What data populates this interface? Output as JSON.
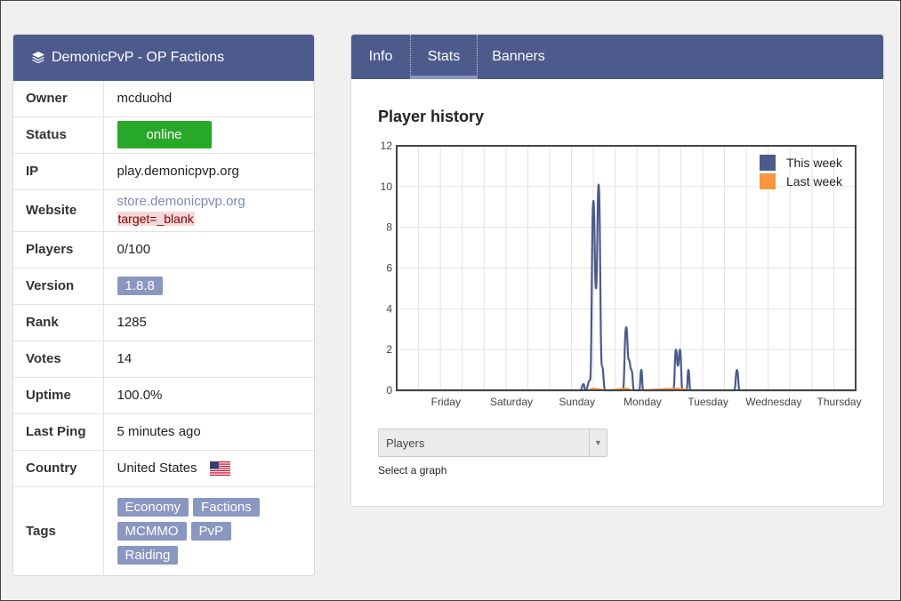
{
  "server": {
    "title": "DemonicPvP - OP Factions"
  },
  "info": {
    "owner_label": "Owner",
    "owner": "mcduohd",
    "status_label": "Status",
    "status": "online",
    "ip_label": "IP",
    "ip": "play.demonicpvp.org",
    "website_label": "Website",
    "website": "store.demonicpvp.org",
    "website_attr": "target=_blank",
    "players_label": "Players",
    "players": "0/100",
    "version_label": "Version",
    "version": "1.8.8",
    "rank_label": "Rank",
    "rank": "1285",
    "votes_label": "Votes",
    "votes": "14",
    "uptime_label": "Uptime",
    "uptime": "100.0%",
    "lastping_label": "Last Ping",
    "lastping": "5 minutes ago",
    "country_label": "Country",
    "country": "United States",
    "tags_label": "Tags",
    "tags": [
      "Economy",
      "Factions",
      "MCMMO",
      "PvP",
      "Raiding"
    ]
  },
  "tabs": [
    "Info",
    "Stats",
    "Banners"
  ],
  "active_tab": "Stats",
  "chart_title": "Player history",
  "select": {
    "value": "Players",
    "hint": "Select a graph"
  },
  "colors": {
    "header": "#4d5a8c",
    "status_online": "#28a828",
    "badge": "#8a97c0",
    "this_week": "#4d5a8c",
    "last_week": "#f7963c"
  },
  "chart_data": {
    "type": "line",
    "title": "Player history",
    "x_ticks": [
      "Friday",
      "Saturday",
      "Sunday",
      "Monday",
      "Tuesday",
      "Wednesday",
      "Thursday"
    ],
    "ylim": [
      0,
      12
    ],
    "y_ticks": [
      0,
      2,
      4,
      6,
      8,
      10,
      12
    ],
    "grid": true,
    "legend_position": "top-right",
    "series": [
      {
        "name": "This week",
        "color": "#4d5a8c",
        "points": [
          [
            0,
            0
          ],
          [
            2.8,
            0
          ],
          [
            2.85,
            0.3
          ],
          [
            2.88,
            0
          ],
          [
            2.95,
            0.5
          ],
          [
            3.0,
            9.3
          ],
          [
            3.04,
            5.0
          ],
          [
            3.08,
            10.1
          ],
          [
            3.13,
            1.2
          ],
          [
            3.18,
            0
          ],
          [
            3.45,
            0
          ],
          [
            3.5,
            3.1
          ],
          [
            3.54,
            1.5
          ],
          [
            3.58,
            1.0
          ],
          [
            3.62,
            0
          ],
          [
            3.7,
            0
          ],
          [
            3.73,
            1.0
          ],
          [
            3.76,
            0
          ],
          [
            4.22,
            0
          ],
          [
            4.26,
            2.0
          ],
          [
            4.29,
            1.2
          ],
          [
            4.32,
            2.0
          ],
          [
            4.36,
            0
          ],
          [
            4.42,
            0
          ],
          [
            4.45,
            1.0
          ],
          [
            4.48,
            0
          ],
          [
            5.15,
            0
          ],
          [
            5.19,
            1.0
          ],
          [
            5.23,
            0
          ],
          [
            7,
            0
          ]
        ]
      },
      {
        "name": "Last week",
        "color": "#f7963c",
        "points": [
          [
            0,
            0
          ],
          [
            2.9,
            0
          ],
          [
            3.0,
            0.08
          ],
          [
            3.2,
            0
          ],
          [
            3.5,
            0.08
          ],
          [
            3.6,
            0
          ],
          [
            4.3,
            0.08
          ],
          [
            4.5,
            0
          ],
          [
            7,
            0
          ]
        ]
      }
    ]
  }
}
